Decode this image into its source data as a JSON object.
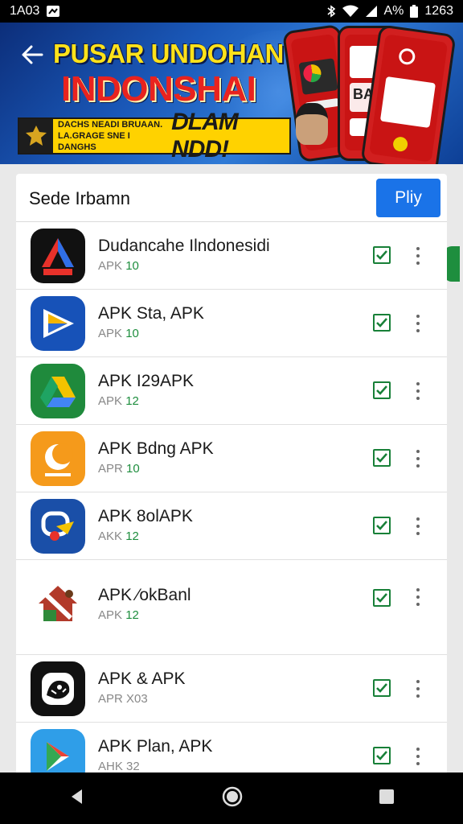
{
  "status_bar": {
    "time": "1A03",
    "clock_right": "1263",
    "battery_text": "A%"
  },
  "banner": {
    "title_line1": "PUSAR UNDOHAN",
    "title_line2": "INDONSHAI",
    "strip_sub_line1": "DACHS  NEADI  BRUAAN.",
    "strip_sub_line2": "LA.GRAGE SNE I DANGHS",
    "strip_big": "DLAM NDD!",
    "phone_text": "BAN"
  },
  "list": {
    "title": "Sede Irbamn",
    "play_button": "Pliy",
    "apps": [
      {
        "name": "Dudancahe Ilndonesidi",
        "meta_prefix": "APK",
        "meta_num": "10",
        "icon": "tent-triangle-icon"
      },
      {
        "name": "APK Sta, APK",
        "meta_prefix": "APK",
        "meta_num": "10",
        "icon": "play-arrow-icon"
      },
      {
        "name": "APK I29APK",
        "meta_prefix": "APK",
        "meta_num": "12",
        "icon": "drive-triangle-icon"
      },
      {
        "name": "APK Bdng APK",
        "meta_prefix": "APR",
        "meta_num": "10",
        "icon": "crescent-icon"
      },
      {
        "name": "APK 8olAPK",
        "meta_prefix": "AKK",
        "meta_num": "12",
        "icon": "chat-bubble-icon"
      },
      {
        "name": "APK ∕okBanl",
        "meta_prefix": "APK",
        "meta_num": "12",
        "icon": "house-icon"
      },
      {
        "name": "APK & APK",
        "meta_prefix": "APR",
        "meta_num": "X03",
        "icon": "wild-animal-icon"
      },
      {
        "name": "APK Plan, APK",
        "meta_prefix": "AHK",
        "meta_num": "32",
        "icon": "google-play-icon"
      }
    ]
  },
  "colors": {
    "accent": "#1a73e8",
    "check": "#188038",
    "banner_red": "#e8231f",
    "banner_yellow": "#ffe21a"
  }
}
